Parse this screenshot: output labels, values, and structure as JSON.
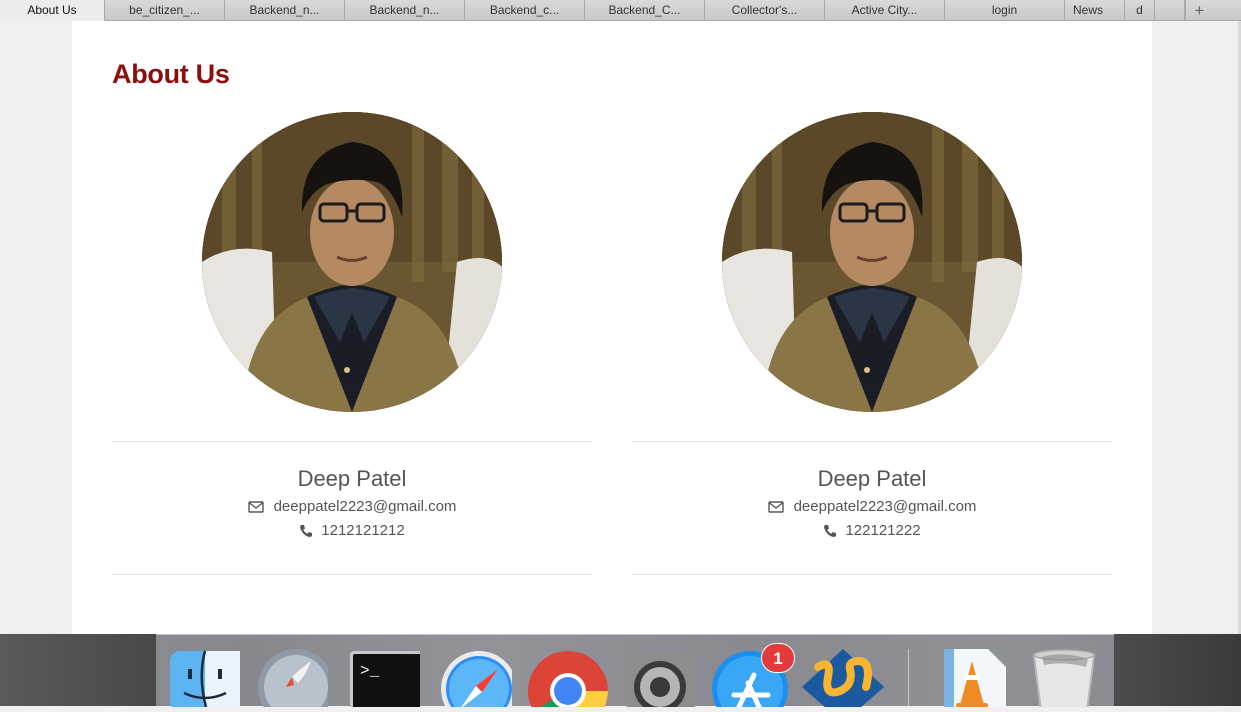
{
  "browser": {
    "tabs": [
      {
        "label": "About Us",
        "active": true
      },
      {
        "label": "be_citizen_..."
      },
      {
        "label": "Backend_n..."
      },
      {
        "label": "Backend_n..."
      },
      {
        "label": "Backend_c..."
      },
      {
        "label": "Backend_C..."
      },
      {
        "label": "Collector's..."
      },
      {
        "label": "Active City..."
      },
      {
        "label": "login"
      },
      {
        "label": "News"
      },
      {
        "label": "d"
      }
    ],
    "new_tab_label": "+"
  },
  "page": {
    "title": "About Us",
    "title_color": "#8b0f0f",
    "members": [
      {
        "name": "Deep Patel",
        "email": "deeppatel2223@gmail.com",
        "phone": "1212121212",
        "email_icon": "envelope-icon",
        "phone_icon": "phone-icon"
      },
      {
        "name": "Deep Patel",
        "email": "deeppatel2223@gmail.com",
        "phone": "122121222",
        "email_icon": "envelope-icon",
        "phone_icon": "phone-icon"
      }
    ]
  },
  "dock": {
    "apps": [
      "finder-icon",
      "launchpad-icon",
      "terminal-icon",
      "safari-icon",
      "chrome-icon",
      "system-preferences-icon",
      "app-store-icon",
      "filezilla-icon",
      "vlc-icon",
      "trash-icon"
    ],
    "app_store_badge": "1"
  }
}
